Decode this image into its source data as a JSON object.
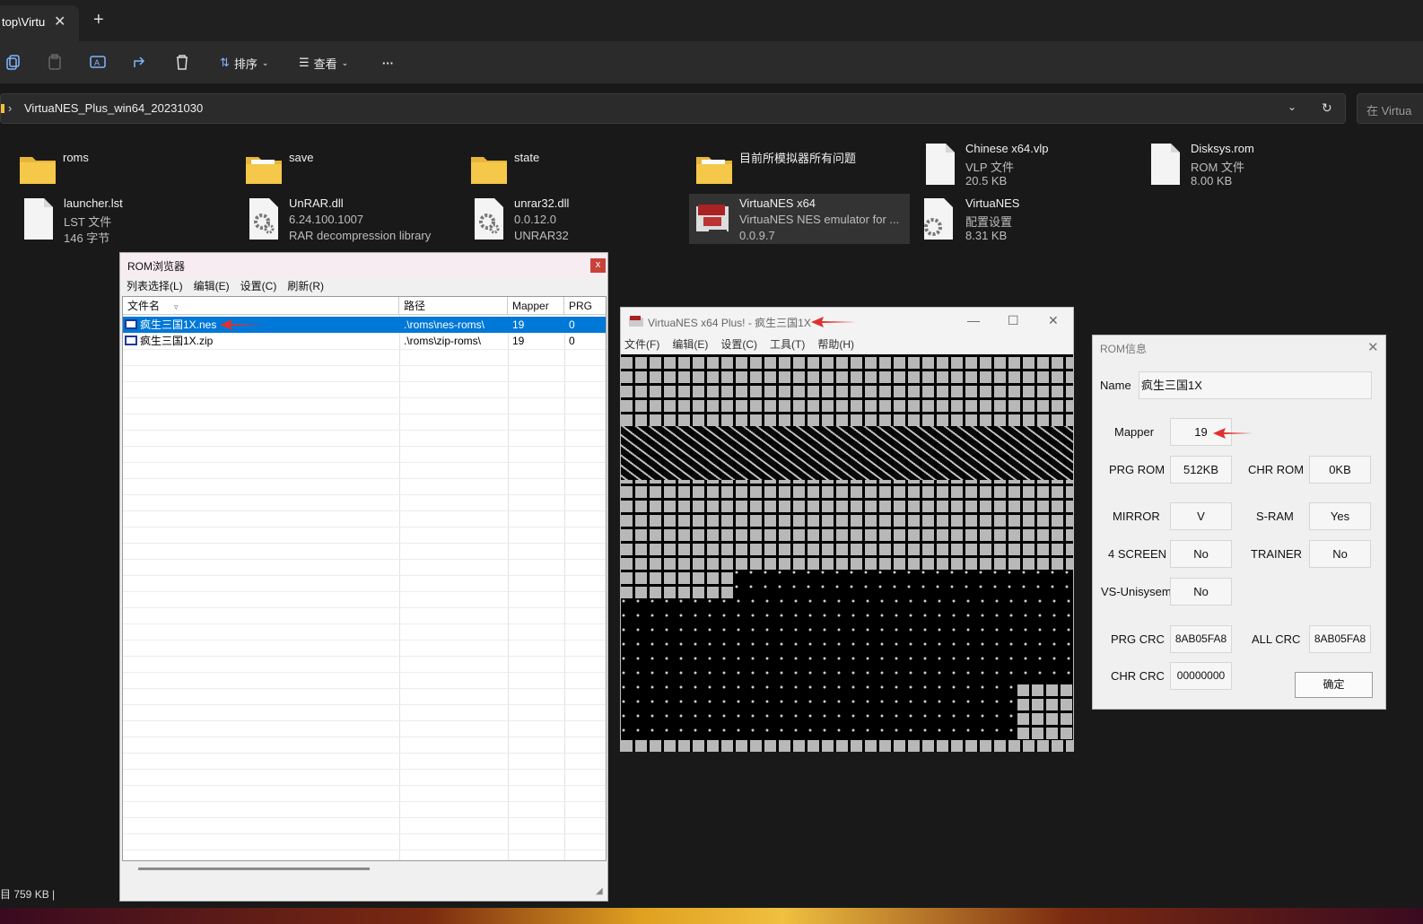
{
  "explorer": {
    "tab_title": "top\\Virtu",
    "toolbar": {
      "sort_label": "排序",
      "view_label": "查看",
      "more_label": "···"
    },
    "address": "VirtuaNES_Plus_win64_20231030",
    "search_placeholder": "在 Virtua",
    "files": [
      {
        "name": "roms",
        "type": "folder"
      },
      {
        "name": "save",
        "type": "folder"
      },
      {
        "name": "state",
        "type": "folder"
      },
      {
        "name": "目前所模拟器所有问题",
        "type": "folder"
      },
      {
        "name": "Chinese x64.vlp",
        "line2": "VLP 文件",
        "line3": "20.5 KB",
        "type": "file"
      },
      {
        "name": "Disksys.rom",
        "line2": "ROM 文件",
        "line3": "8.00 KB",
        "type": "file"
      },
      {
        "name": "launcher.lst",
        "line2": "LST 文件",
        "line3": "146 字节",
        "type": "file"
      },
      {
        "name": "UnRAR.dll",
        "line2": "6.24.100.1007",
        "line3": "RAR decompression library",
        "type": "dll"
      },
      {
        "name": "unrar32.dll",
        "line2": "0.0.12.0",
        "line3": "UNRAR32",
        "type": "dll"
      },
      {
        "name": "VirtuaNES x64",
        "line2": "VirtuaNES NES emulator for ...",
        "line3": "0.0.9.7",
        "type": "exe"
      },
      {
        "name": "VirtuaNES",
        "line2": "配置设置",
        "line3": "8.31 KB",
        "type": "dll"
      }
    ],
    "status": "目 759 KB  |"
  },
  "rom_browser": {
    "title": "ROM浏览器",
    "close": "x",
    "menu": [
      "列表选择(L)",
      "编辑(E)",
      "设置(C)",
      "刷新(R)"
    ],
    "columns": [
      "文件名",
      "路径",
      "Mapper",
      "PRG"
    ],
    "rows": [
      {
        "name": "疯生三国1X.nes",
        "path": ".\\roms\\nes-roms\\",
        "mapper": "19",
        "prg": "0"
      },
      {
        "name": "疯生三国1X.zip",
        "path": ".\\roms\\zip-roms\\",
        "mapper": "19",
        "prg": "0"
      }
    ]
  },
  "emulator": {
    "title": "VirtuaNES x64 Plus! - 疯生三国1X",
    "menu": [
      "文件(F)",
      "编辑(E)",
      "设置(C)",
      "工具(T)",
      "帮助(H)"
    ]
  },
  "rom_info": {
    "title": "ROM信息",
    "name_label": "Name",
    "name_value": "疯生三国1X",
    "mapper_label": "Mapper",
    "mapper_value": "19",
    "prg_rom_label": "PRG ROM",
    "prg_rom_value": "512KB",
    "chr_rom_label": "CHR ROM",
    "chr_rom_value": "0KB",
    "mirror_label": "MIRROR",
    "mirror_value": "V",
    "sram_label": "S-RAM",
    "sram_value": "Yes",
    "four_screen_label": "4 SCREEN",
    "four_screen_value": "No",
    "trainer_label": "TRAINER",
    "trainer_value": "No",
    "vs_label": "VS-Unisysem",
    "vs_value": "No",
    "prg_crc_label": "PRG CRC",
    "prg_crc_value": "8AB05FA8",
    "all_crc_label": "ALL CRC",
    "all_crc_value": "8AB05FA8",
    "chr_crc_label": "CHR CRC",
    "chr_crc_value": "00000000",
    "ok_label": "确定"
  },
  "colors": {
    "accent": "#0078d7",
    "arrow": "#e03030",
    "folder": "#f0c040"
  }
}
